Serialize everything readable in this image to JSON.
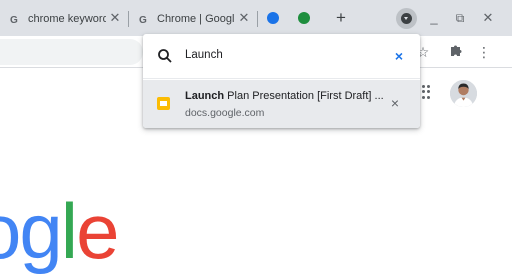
{
  "tabs": [
    {
      "title": "chrome keywords"
    },
    {
      "title": "Chrome | Google"
    }
  ],
  "colors": {
    "tab_strip": "#dee1e6",
    "google_blue": "#4285f4",
    "google_green": "#34a853",
    "google_red": "#ea4335",
    "docs_yellow": "#fbbc04",
    "accent_blue": "#1a73e8"
  },
  "icons": {
    "new_tab": "+",
    "minimize": "_",
    "maximize": "⧉",
    "close": "✕"
  },
  "tab_search": {
    "query": "Launch",
    "clear_glyph": "×",
    "results": [
      {
        "title_match": "Launch",
        "title_rest": " Plan Presentation [First Draft] - Google Slides",
        "url": "docs.google.com",
        "close_glyph": "×"
      }
    ]
  },
  "page": {
    "logo_parts": [
      "o",
      "g",
      "l",
      "e"
    ]
  }
}
